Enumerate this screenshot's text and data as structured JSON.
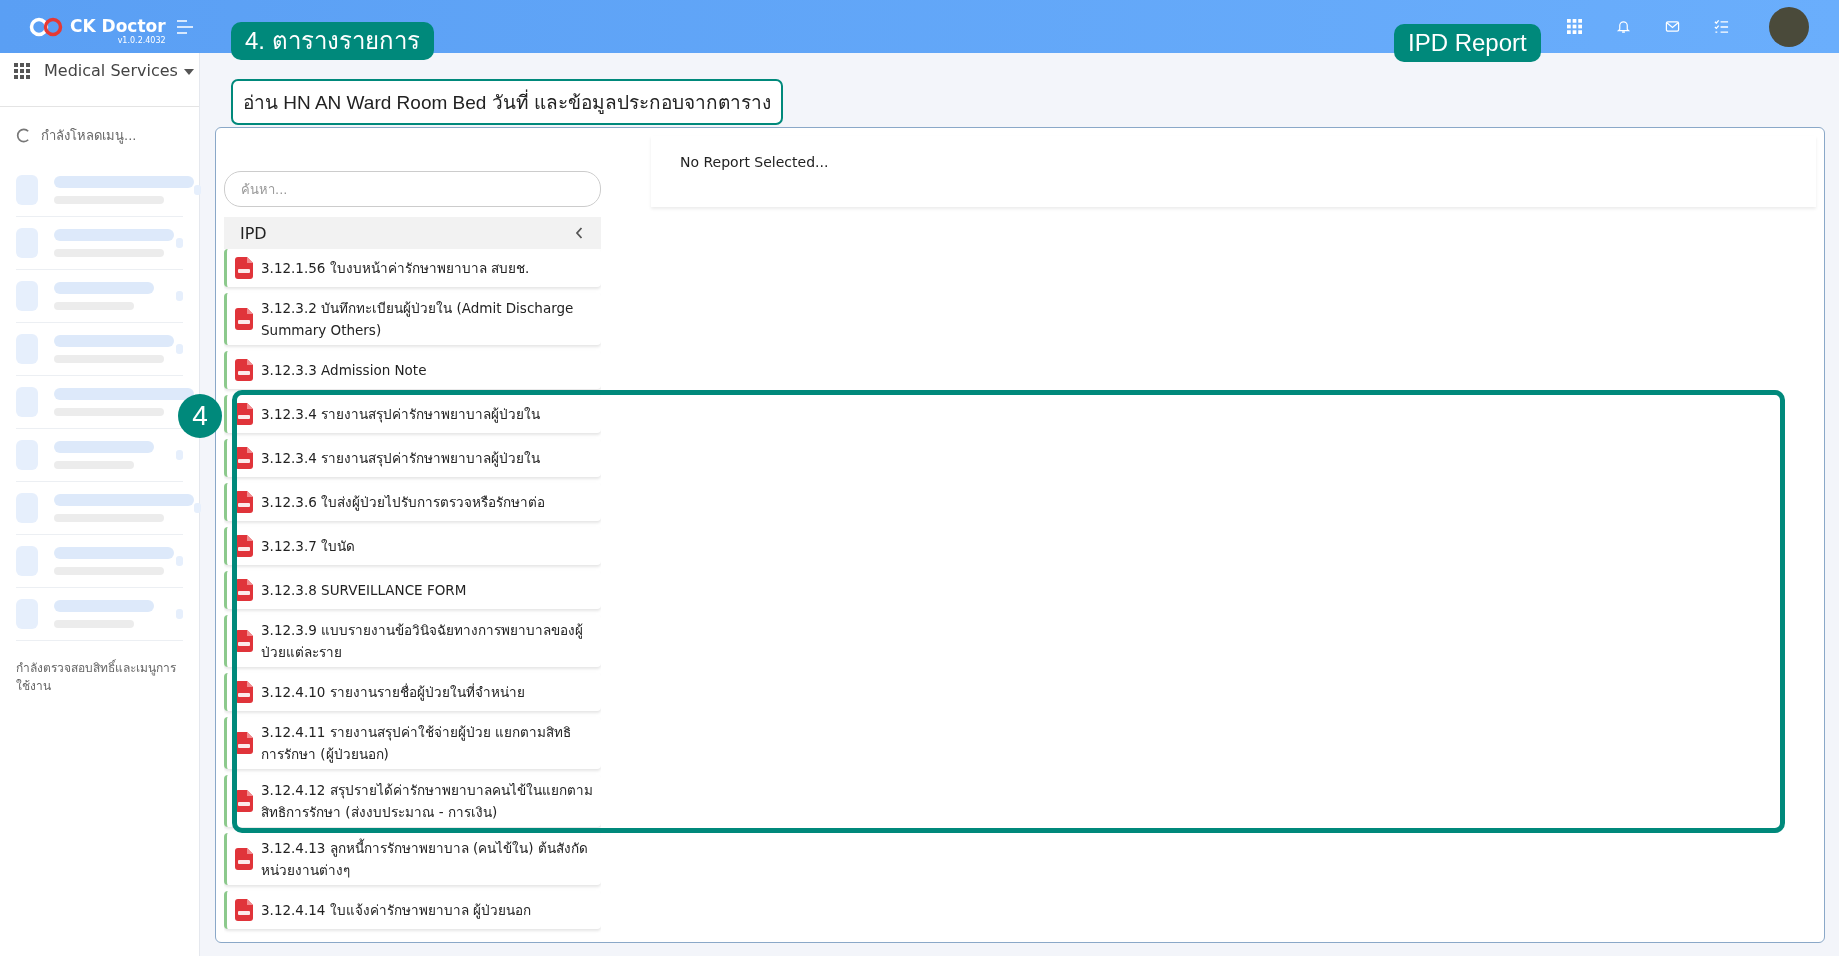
{
  "header": {
    "brand": "CK Doctor",
    "version": "v1.0.2.4032"
  },
  "annotations": {
    "section_tag": "4. ตารางรายการ",
    "report_tag": "IPD Report",
    "callout": "อ่าน HN AN Ward Room Bed วันที่ และข้อมูลประกอบจากตาราง",
    "frame_number": "4"
  },
  "sidebar": {
    "module": "Medical Services",
    "loading_text": "กำลังโหลดเมนู...",
    "status_text": "กำลังตรวจสอบสิทธิ์และเมนูการใช้งาน"
  },
  "report_list": {
    "search": {
      "placeholder": "ค้นหา..."
    },
    "group": {
      "title": "IPD"
    },
    "items": [
      {
        "title": "3.12.1.56 ใบงบหน้าค่ารักษาพยาบาล สบยช."
      },
      {
        "title": "3.12.3.2 บันทึกทะเบียนผู้ป่วยใน (Admit Discharge Summary Others)"
      },
      {
        "title": "3.12.3.3 Admission Note"
      },
      {
        "title": "3.12.3.4 รายงานสรุปค่ารักษาพยาบาลผู้ป่วยใน"
      },
      {
        "title": "3.12.3.4 รายงานสรุปค่ารักษาพยาบาลผู้ป่วยใน"
      },
      {
        "title": "3.12.3.6 ใบส่งผู้ป่วยไปรับการตรวจหรือรักษาต่อ"
      },
      {
        "title": "3.12.3.7 ใบนัด"
      },
      {
        "title": "3.12.3.8 SURVEILLANCE FORM"
      },
      {
        "title": "3.12.3.9 แบบรายงานข้อวินิจฉัยทางการพยาบาลของผู้ป่วยแต่ละราย"
      },
      {
        "title": "3.12.4.10 รายงานรายชื่อผู้ป่วยในที่จำหน่าย"
      },
      {
        "title": "3.12.4.11 รายงานสรุปค่าใช้จ่ายผู้ป่วย แยกตามสิทธิการรักษา (ผู้ป่วยนอก)"
      },
      {
        "title": "3.12.4.12 สรุปรายได้ค่ารักษาพยาบาลคนไข้ในแยกตามสิทธิการรักษา (ส่งงบประมาณ - การเงิน)"
      },
      {
        "title": "3.12.4.13 ลูกหนี้การรักษาพยาบาล (คนไข้ใน) ต้นสังกัดหน่วยงานต่างๆ"
      },
      {
        "title": "3.12.4.14 ใบแจ้งค่ารักษาพยาบาล ผู้ป่วยนอก"
      }
    ]
  },
  "report_view": {
    "message": "No Report Selected..."
  }
}
